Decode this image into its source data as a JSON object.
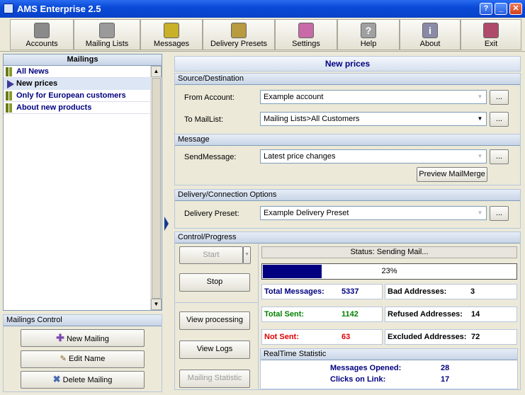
{
  "window": {
    "title": "AMS Enterprise 2.5",
    "help": "?",
    "minimize": "_",
    "maximize": "□",
    "close": "✕"
  },
  "toolbar": [
    {
      "label": "Accounts",
      "icon": "accounts-icon",
      "color": "#8a8a8a"
    },
    {
      "label": "Mailing Lists",
      "icon": "mailing-lists-icon",
      "color": "#9a9a9a"
    },
    {
      "label": "Messages",
      "icon": "messages-icon",
      "color": "#c8b028"
    },
    {
      "label": "Delivery Presets",
      "icon": "delivery-presets-icon",
      "color": "#b89a40"
    },
    {
      "label": "Settings",
      "icon": "settings-icon",
      "color": "#c86aa8"
    },
    {
      "label": "Help",
      "icon": "help-icon",
      "color": "#a0a0a0",
      "glyph": "?"
    },
    {
      "label": "About",
      "icon": "about-icon",
      "color": "#8a8aa8",
      "glyph": "i"
    },
    {
      "label": "Exit",
      "icon": "exit-icon",
      "color": "#b04a6a"
    }
  ],
  "mailings": {
    "title": "Mailings",
    "items": [
      "All News",
      "New prices",
      "Only for European customers",
      "About new products"
    ],
    "selected": 1
  },
  "mailings_control": {
    "title": "Mailings Control",
    "new": "New Mailing",
    "edit": "Edit Name",
    "delete": "Delete Mailing"
  },
  "main": {
    "title": "New prices",
    "source": {
      "title": "Source/Destination",
      "from_label": "From Account:",
      "from_value": "Example account",
      "to_label": "To MailList:",
      "to_value": "Mailing Lists>All Customers",
      "browse": "..."
    },
    "message": {
      "title": "Message",
      "send_label": "SendMessage:",
      "send_value": "Latest price changes",
      "preview": "Preview MailMerge"
    },
    "delivery": {
      "title": "Delivery/Connection Options",
      "preset_label": "Delivery Preset:",
      "preset_value": "Example Delivery Preset"
    },
    "control": {
      "title": "Control/Progress",
      "start": "Start",
      "stop": "Stop",
      "view_processing": "View processing",
      "view_logs": "View Logs",
      "mailing_statistic": "Mailing Statistic",
      "status": "Status: Sending Mail...",
      "progress_text": "23%",
      "progress": 0.23
    }
  },
  "stats": {
    "total_messages_label": "Total Messages:",
    "total_messages": "5337",
    "total_sent_label": "Total Sent:",
    "total_sent": "1142",
    "not_sent_label": "Not Sent:",
    "not_sent": "63",
    "bad_label": "Bad Addresses:",
    "bad": "3",
    "refused_label": "Refused Addresses:",
    "refused": "14",
    "excluded_label": "Excluded Addresses:",
    "excluded": "72",
    "realtime_title": "RealTime Statistic",
    "opened_label": "Messages Opened:",
    "opened": "28",
    "clicks_label": "Clicks on Link:",
    "clicks": "17"
  },
  "colors": {
    "progress_fill": "#000080",
    "sent_green": "#008000",
    "not_sent_red": "#e00000",
    "stat_blue": "#000080"
  }
}
